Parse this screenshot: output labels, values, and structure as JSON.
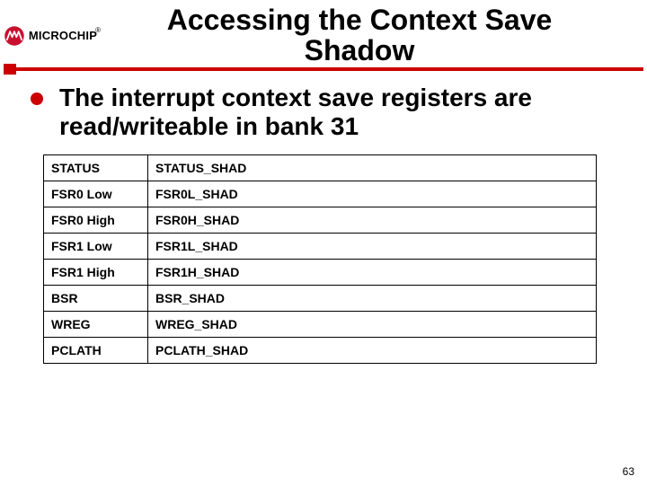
{
  "logo": {
    "brand": "MICROCHIP",
    "reg": "®"
  },
  "title_line1": "Accessing the Context Save",
  "title_line2": "Shadow",
  "bullet": "The interrupt context save registers are read/writeable in bank 31",
  "table": {
    "rows": [
      {
        "c1": "STATUS",
        "c2": "STATUS_SHAD"
      },
      {
        "c1": "FSR0 Low",
        "c2": "FSR0L_SHAD"
      },
      {
        "c1": "FSR0 High",
        "c2": "FSR0H_SHAD"
      },
      {
        "c1": "FSR1 Low",
        "c2": "FSR1L_SHAD"
      },
      {
        "c1": "FSR1 High",
        "c2": "FSR1H_SHAD"
      },
      {
        "c1": "BSR",
        "c2": "BSR_SHAD"
      },
      {
        "c1": "WREG",
        "c2": "WREG_SHAD"
      },
      {
        "c1": "PCLATH",
        "c2": "PCLATH_SHAD"
      }
    ]
  },
  "page_number": "63"
}
